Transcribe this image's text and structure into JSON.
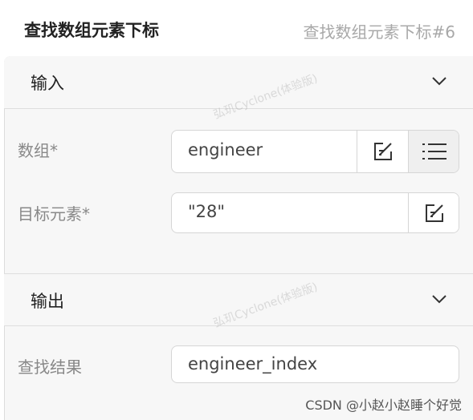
{
  "header": {
    "title": "查找数组元素下标",
    "subtitle": "查找数组元素下标#6"
  },
  "input_section": {
    "label": "输入",
    "array_label": "数组*",
    "array_value": "engineer",
    "target_label": "目标元素*",
    "target_value": "\"28\""
  },
  "output_section": {
    "label": "输出",
    "result_label": "查找结果",
    "result_value": "engineer_index"
  },
  "watermark": "弘玑Cyclone(体验版)",
  "footer": {
    "credit": "CSDN @小赵小赵睡个好觉"
  }
}
